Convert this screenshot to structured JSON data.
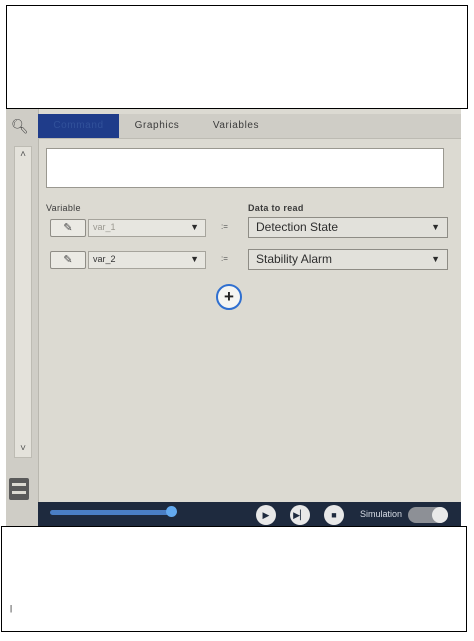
{
  "tabs": [
    {
      "label": "Command",
      "active": true
    },
    {
      "label": "Graphics",
      "active": false
    },
    {
      "label": "Variables",
      "active": false
    }
  ],
  "columns": {
    "variable": "Variable",
    "data": "Data to read"
  },
  "rows": [
    {
      "variable": "var_1",
      "operator": ":=",
      "data": "Detection State"
    },
    {
      "variable": "var_2",
      "operator": ":=",
      "data": "Stability Alarm"
    }
  ],
  "footer": {
    "simulation_label": "Simulation",
    "simulation_on": false
  },
  "icons": {
    "search": "search-icon",
    "scroll_up": "chevron-up-icon",
    "scroll_down": "chevron-down-icon",
    "menu": "menu-icon",
    "edit": "pencil-icon",
    "add": "plus-icon",
    "play": "play-icon",
    "step": "skip-icon",
    "stop": "stop-icon"
  },
  "colors": {
    "active_tab": "#1f3c8a",
    "footer": "#1e2a3e",
    "slider": "#4a7ec4",
    "add_ring": "#2f6fd0"
  }
}
